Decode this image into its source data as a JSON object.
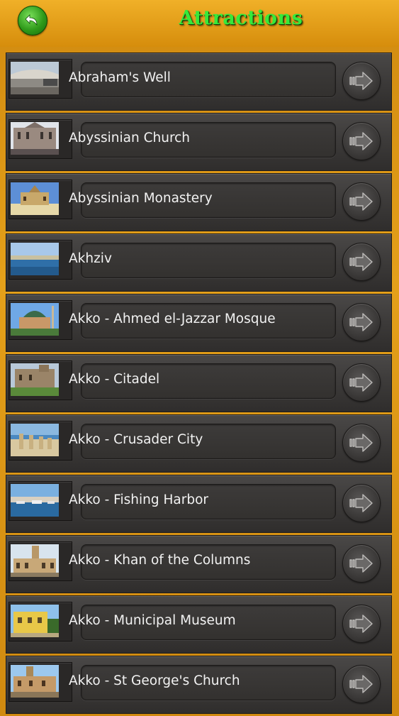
{
  "header": {
    "title": "Attractions",
    "back_icon": "back-arrow-icon",
    "back_color": "#2f9a1a",
    "title_color": "#37e83a"
  },
  "items": [
    {
      "label": "Abraham's Well",
      "thumb": "bridge"
    },
    {
      "label": "Abyssinian Church",
      "thumb": "church"
    },
    {
      "label": "Abyssinian Monastery",
      "thumb": "monastery"
    },
    {
      "label": "Akhziv",
      "thumb": "coast"
    },
    {
      "label": "Akko - Ahmed el-Jazzar Mosque",
      "thumb": "mosque"
    },
    {
      "label": "Akko - Citadel",
      "thumb": "citadel"
    },
    {
      "label": "Akko - Crusader City",
      "thumb": "ruins"
    },
    {
      "label": "Akko - Fishing Harbor",
      "thumb": "harbor"
    },
    {
      "label": "Akko - Khan of the Columns",
      "thumb": "khan"
    },
    {
      "label": "Akko - Municipal Museum",
      "thumb": "museum"
    },
    {
      "label": "Akko - St George's Church",
      "thumb": "stgeorge"
    }
  ],
  "row_action_icon": "arrow-right-icon"
}
